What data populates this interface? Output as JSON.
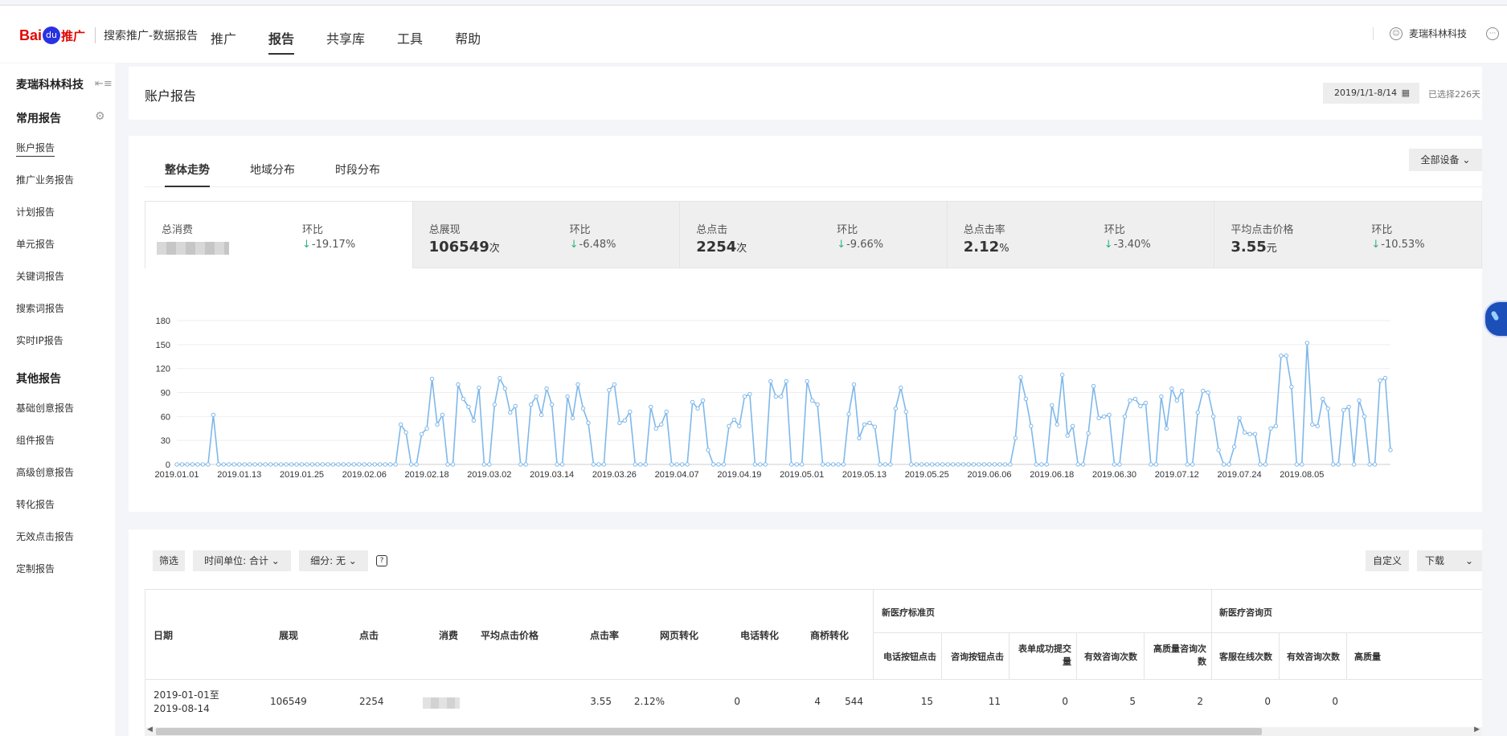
{
  "header": {
    "logo_bai": "Bai",
    "logo_du": "du",
    "logo_tg": "推广",
    "product": "搜索推广-数据报告",
    "nav": [
      "推广",
      "报告",
      "共享库",
      "工具",
      "帮助"
    ],
    "active_nav": "报告",
    "user": "麦瑞科林科技"
  },
  "sidebar": {
    "account": "麦瑞科林科技",
    "common_title": "常用报告",
    "common_items": [
      "账户报告",
      "推广业务报告",
      "计划报告",
      "单元报告",
      "关键词报告",
      "搜索词报告",
      "实时IP报告"
    ],
    "other_title": "其他报告",
    "other_items": [
      "基础创意报告",
      "组件报告",
      "高级创意报告",
      "转化报告",
      "无效点击报告",
      "定制报告"
    ]
  },
  "page": {
    "title": "账户报告",
    "date_range": "2019/1/1-8/14",
    "selected_days": "已选择226天"
  },
  "trend": {
    "tabs": [
      "整体走势",
      "地域分布",
      "时段分布"
    ],
    "device_filter": "全部设备",
    "ratio_label": "环比",
    "metrics": [
      {
        "label": "总消费",
        "value": "",
        "unit": "",
        "ratio": "-19.17%"
      },
      {
        "label": "总展现",
        "value": "106549",
        "unit": "次",
        "ratio": "-6.48%"
      },
      {
        "label": "总点击",
        "value": "2254",
        "unit": "次",
        "ratio": "-9.66%"
      },
      {
        "label": "总点击率",
        "value": "2.12",
        "unit": "%",
        "ratio": "-3.40%"
      },
      {
        "label": "平均点击价格",
        "value": "3.55",
        "unit": "元",
        "ratio": "-10.53%"
      }
    ]
  },
  "chart_data": {
    "type": "line",
    "color": "#7fb8ea",
    "ylim": [
      0,
      180
    ],
    "yticks": [
      0,
      30,
      60,
      90,
      120,
      150,
      180
    ],
    "xticks": [
      "2019.01.01",
      "2019.01.13",
      "2019.01.25",
      "2019.02.06",
      "2019.02.18",
      "2019.03.02",
      "2019.03.14",
      "2019.03.26",
      "2019.04.07",
      "2019.04.19",
      "2019.05.01",
      "2019.05.13",
      "2019.05.25",
      "2019.06.06",
      "2019.06.18",
      "2019.06.30",
      "2019.07.12",
      "2019.07.24",
      "2019.08.05"
    ],
    "x_start": "2019.01.01",
    "x_end": "2019.08.14",
    "values": [
      0,
      0,
      0,
      0,
      0,
      0,
      0,
      62,
      0,
      0,
      0,
      0,
      0,
      0,
      0,
      0,
      0,
      0,
      0,
      0,
      0,
      0,
      0,
      0,
      0,
      0,
      0,
      0,
      0,
      0,
      0,
      0,
      0,
      0,
      0,
      0,
      0,
      0,
      0,
      0,
      0,
      0,
      0,
      50,
      40,
      0,
      0,
      38,
      45,
      107,
      50,
      62,
      0,
      0,
      100,
      82,
      72,
      55,
      96,
      0,
      0,
      75,
      108,
      95,
      65,
      73,
      0,
      0,
      75,
      85,
      62,
      95,
      75,
      0,
      0,
      85,
      58,
      100,
      70,
      52,
      0,
      0,
      0,
      93,
      100,
      52,
      55,
      66,
      0,
      0,
      0,
      72,
      45,
      50,
      66,
      0,
      0,
      0,
      0,
      78,
      70,
      80,
      18,
      0,
      0,
      0,
      48,
      56,
      48,
      85,
      88,
      0,
      0,
      0,
      104,
      85,
      85,
      104,
      0,
      0,
      0,
      104,
      80,
      75,
      0,
      0,
      0,
      0,
      0,
      63,
      100,
      33,
      50,
      52,
      47,
      0,
      0,
      0,
      70,
      96,
      66,
      0,
      0,
      0,
      0,
      0,
      0,
      0,
      0,
      0,
      0,
      0,
      0,
      0,
      0,
      0,
      0,
      0,
      0,
      0,
      0,
      33,
      109,
      82,
      48,
      0,
      0,
      0,
      74,
      50,
      112,
      36,
      48,
      0,
      0,
      39,
      98,
      58,
      60,
      62,
      0,
      0,
      60,
      80,
      82,
      73,
      77,
      0,
      0,
      85,
      45,
      95,
      80,
      92,
      0,
      0,
      65,
      92,
      90,
      60,
      18,
      0,
      0,
      22,
      58,
      40,
      38,
      38,
      0,
      0,
      45,
      48,
      136,
      136,
      97,
      0,
      0,
      152,
      50,
      48,
      82,
      70,
      0,
      0,
      68,
      72,
      0,
      80,
      60,
      0,
      0,
      105,
      108,
      18
    ]
  },
  "table": {
    "filter_btn": "筛选",
    "time_unit": "时间单位: 合计",
    "breakdown": "细分: 无",
    "customize": "自定义",
    "download": "下载",
    "group1": "新医疗标准页",
    "group2": "新医疗咨询页",
    "columns": [
      "日期",
      "展现",
      "点击",
      "消费",
      "平均点击价格",
      "点击率",
      "网页转化",
      "电话转化",
      "商桥转化"
    ],
    "sub_columns1": [
      "电话按钮点击",
      "咨询按钮点击",
      "表单成功提交量",
      "有效咨询次数",
      "高质量咨询次数"
    ],
    "sub_columns2": [
      "客服在线次数",
      "有效咨询次数",
      "高质量"
    ],
    "row": {
      "date": "2019-01-01至2019-08-14",
      "impressions": "106549",
      "clicks": "2254",
      "cost": "",
      "avg_cpc": "3.55",
      "ctr": "2.12%",
      "web_conv": "0",
      "phone_conv": "4",
      "bridge_conv": "544",
      "s1": [
        "15",
        "11",
        "0",
        "5",
        "2"
      ],
      "s2": [
        "0",
        "0"
      ]
    }
  }
}
